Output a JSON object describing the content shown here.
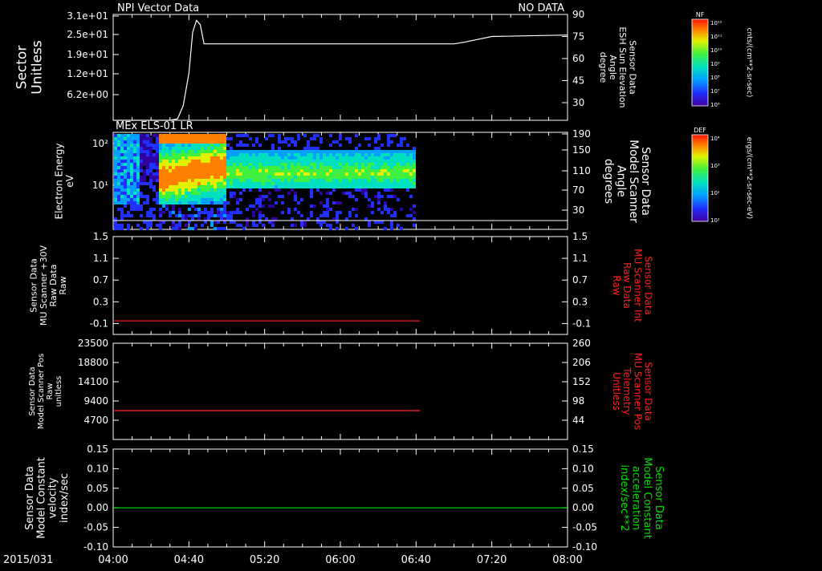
{
  "date_label": "2015/031",
  "time_axis": {
    "start": "04:00",
    "end": "08:00",
    "ticks": [
      "04:00",
      "04:40",
      "05:20",
      "06:00",
      "06:40",
      "07:20",
      "08:00"
    ]
  },
  "colors": {
    "background": "#000000",
    "axis": "#ffffff",
    "red_trace": "#ff2020",
    "green_trace": "#00e000"
  },
  "chart_data": [
    {
      "type": "line",
      "title_left": "NPI Vector Data",
      "title_right": "NO DATA",
      "ylabel_left": [
        "Sector",
        "Unitless"
      ],
      "yticks_left": [
        "3.1e+01",
        "2.5e+01",
        "1.9e+01",
        "1.2e+01",
        "6.2e+00"
      ],
      "ylabel_right": [
        "Sensor Data",
        "ESH Sun Elevation",
        "Angle",
        "degree"
      ],
      "yticks_right": [
        "90",
        "75",
        "60",
        "45",
        "30"
      ],
      "ylim_right": [
        18,
        90
      ],
      "series": [
        {
          "color": "#ffffff",
          "x": [
            "04:00",
            "04:30",
            "04:34",
            "04:37",
            "04:40",
            "04:42",
            "04:44",
            "04:46",
            "04:48",
            "07:00",
            "07:05",
            "07:20",
            "08:00"
          ],
          "y": [
            18,
            18,
            19,
            28,
            50,
            78,
            86,
            83,
            70,
            70,
            71,
            75,
            76
          ]
        }
      ]
    },
    {
      "type": "heatmap",
      "title_left": "MEx ELS-01 LR",
      "ylabel_left": [
        "Electron Energy",
        "eV"
      ],
      "yticks_left": [
        "10²",
        "10¹"
      ],
      "ylabel_right": [
        "Sensor Data",
        "Model Scanner",
        "Angle",
        "degrees"
      ],
      "yticks_right": [
        "190",
        "150",
        "110",
        "70",
        "30"
      ],
      "data_end": "06:40",
      "colorbar": {
        "label": "DEF",
        "units": "ergs/(cm**2-sr-sec-eV)",
        "ticks": [
          "10⁴",
          "10³",
          "10²",
          "10¹"
        ]
      },
      "baseline_line": {
        "y_degrees": 10
      }
    },
    {
      "type": "line",
      "ylabel_left": [
        "Sensor Data",
        "MU Scanner +30V",
        "Raw Data",
        "Raw"
      ],
      "yticks_left": [
        "1.5",
        "1.1",
        "0.7",
        "0.3",
        "-0.1"
      ],
      "ylabel_right": [
        "Sensor Data",
        "MU Scanner Int",
        "Raw Data",
        "Raw"
      ],
      "yticks_right": [
        "1.5",
        "1.1",
        "0.7",
        "0.3",
        "-0.1"
      ],
      "ylim": [
        -0.3,
        1.5
      ],
      "series": [
        {
          "color": "#ff2020",
          "x": [
            "04:00",
            "06:42"
          ],
          "y": [
            -0.05,
            -0.05
          ]
        }
      ]
    },
    {
      "type": "line",
      "ylabel_left": [
        "Sensor Data",
        "Model Scanner Pos",
        "Raw",
        "unitless"
      ],
      "yticks_left": [
        "23500",
        "18800",
        "14100",
        "9400",
        "4700"
      ],
      "ylabel_right": [
        "Sensor Data",
        "MU Scanner Pos",
        "Telemetry",
        "Unitless"
      ],
      "yticks_right": [
        "260",
        "206",
        "152",
        "98",
        "44"
      ],
      "ylim": [
        0,
        23500
      ],
      "series": [
        {
          "color": "#ff2020",
          "x": [
            "04:00",
            "06:42"
          ],
          "y": [
            7050,
            7050
          ]
        }
      ]
    },
    {
      "type": "line",
      "ylabel_left": [
        "Sensor Data",
        "Model Constant",
        "velocity",
        "index/sec"
      ],
      "yticks_left": [
        "0.15",
        "0.10",
        "0.05",
        "0.00",
        "-0.05",
        "-0.10"
      ],
      "ylabel_right": [
        "Sensor Data",
        "Model Constant",
        "acceleration",
        "index/sec**2"
      ],
      "yticks_right": [
        "0.15",
        "0.10",
        "0.05",
        "0.00",
        "-0.05",
        "-0.10"
      ],
      "ylim": [
        -0.1,
        0.15
      ],
      "series": [
        {
          "color": "#00e000",
          "x": [
            "04:00",
            "08:00"
          ],
          "y": [
            0.0,
            0.0
          ]
        }
      ]
    }
  ],
  "colorbars": [
    {
      "label": "NF",
      "units": "cnts/(cm**2-sr-sec)",
      "ticks": [
        "10¹²",
        "10¹¹",
        "10¹⁰",
        "10⁹",
        "10⁸",
        "10⁷",
        "10⁶"
      ]
    },
    {
      "label": "DEF",
      "units": "ergs/(cm**2-sr-sec-eV)",
      "ticks": [
        "10⁴",
        "10³",
        "10²",
        "10¹"
      ]
    }
  ]
}
